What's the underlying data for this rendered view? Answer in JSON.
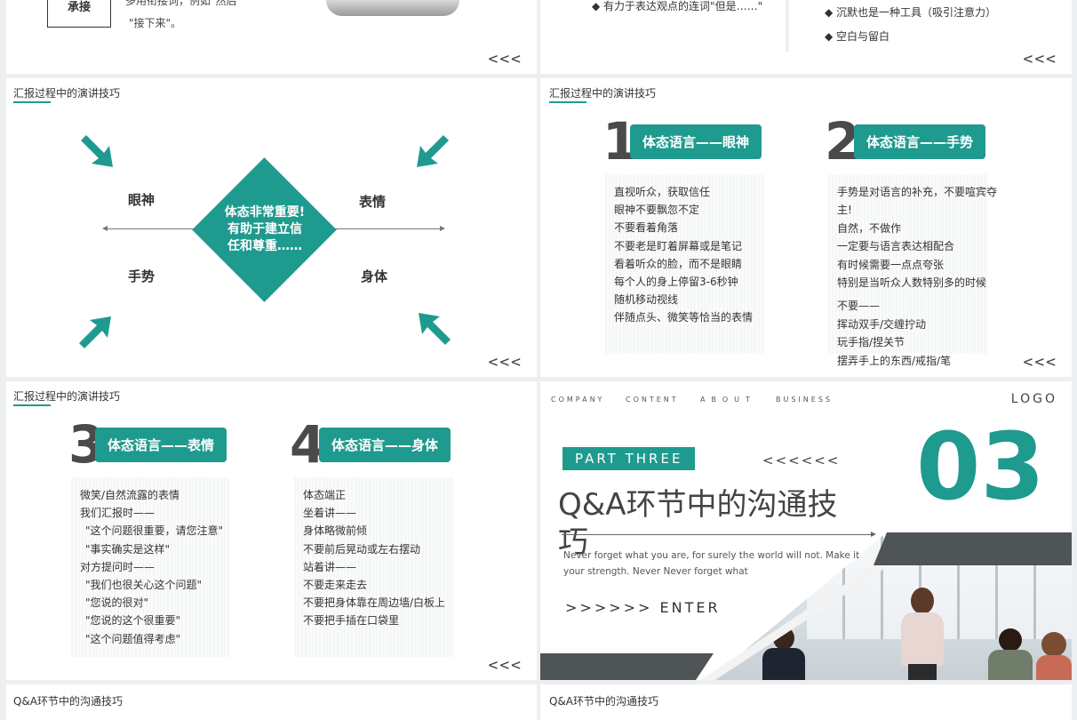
{
  "slide1": {
    "box_label": "承接",
    "text_line1": "多用衔接词，例如\"然后\"",
    "text_line2": "\"接下来\"。",
    "nav": "<<<"
  },
  "slide2": {
    "bullet1": "◆ 有力于表达观点的连词\"但是……\"",
    "bullet2": "◆ 沉默也是一种工具（吸引注意力）",
    "bullet3": "◆ 空白与留白",
    "nav": "<<<"
  },
  "slide3": {
    "title": "汇报过程中的演讲技巧",
    "center_line1": "体态非常重要!",
    "center_line2": "有助于建立信",
    "center_line3": "任和尊重……",
    "label_eyes": "眼神",
    "label_face": "表情",
    "label_gesture": "手势",
    "label_body": "身体",
    "nav": "<<<"
  },
  "slide4": {
    "title": "汇报过程中的演讲技巧",
    "num1": "1",
    "badge1": "体态语言——眼神",
    "list1": [
      "直视听众，获取信任",
      "眼神不要飘忽不定",
      "不要看着角落",
      "不要老是盯着屏幕或是笔记",
      "看着听众的脸，而不是眼睛",
      "每个人的身上停留3-6秒钟",
      "随机移动视线",
      "伴随点头、微笑等恰当的表情"
    ],
    "num2": "2",
    "badge2": "体态语言——手势",
    "list2a": [
      "手势是对语言的补充，不要喧宾夺",
      "主!",
      "自然，不做作",
      "一定要与语言表达相配合",
      "有时候需要一点点夸张",
      "特别是当听众人数特别多的时候"
    ],
    "list2b": [
      "不要——",
      "挥动双手/交缠拧动",
      "玩手指/捏关节",
      "摆弄手上的东西/戒指/笔"
    ],
    "nav": "<<<"
  },
  "slide5": {
    "title": "汇报过程中的演讲技巧",
    "num3": "3",
    "badge3": "体态语言——表情",
    "list3": [
      "微笑/自然流露的表情",
      "我们汇报时——",
      "\"这个问题很重要，请您注意\"",
      "\"事实确实是这样\"",
      "对方提问时——",
      "\"我们也很关心这个问题\"",
      "\"您说的很对\"",
      "\"您说的这个很重要\"",
      "\"这个问题值得考虑\""
    ],
    "num4": "4",
    "badge4": "体态语言——身体",
    "list4": [
      "体态端正",
      "坐着讲——",
      "身体略微前倾",
      "不要前后晃动或左右摆动",
      "站着讲——",
      "不要走来走去",
      "不要把身体靠在周边墙/白板上",
      "不要把手插在口袋里"
    ],
    "nav": "<<<"
  },
  "slide6": {
    "menu": [
      "COMPANY",
      "CONTENT",
      "ABOUT",
      "BUSINESS"
    ],
    "logo": "LOGO",
    "part": "PART THREE",
    "left_arrows": "<<<<<<",
    "section_num": "03",
    "heading_line1": "Q&A环节中的沟通技",
    "heading_line2": "巧",
    "quote_line1": "Never forget what you are, for surely the world will not. Make it",
    "quote_line2": "your strength. Never Never forget what",
    "enter": ">>>>>> ENTER"
  },
  "slide7": {
    "title": "Q&A环节中的沟通技巧"
  },
  "slide8": {
    "title": "Q&A环节中的沟通技巧"
  },
  "colors": {
    "accent": "#1f9a8e",
    "dark": "#4a4a4a"
  }
}
